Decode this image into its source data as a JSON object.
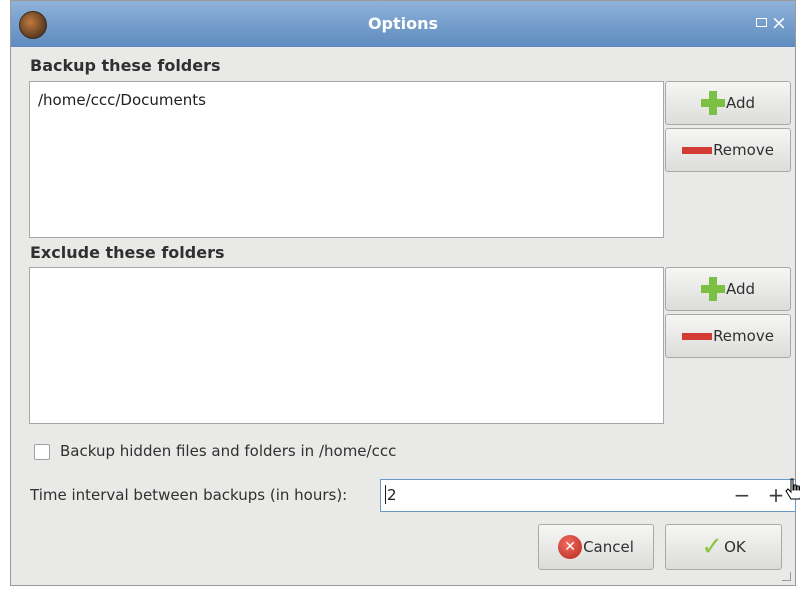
{
  "window": {
    "title": "Options"
  },
  "backup": {
    "label": "Backup these folders",
    "items": [
      "/home/ccc/Documents"
    ],
    "add_label": "Add",
    "remove_label": "Remove"
  },
  "exclude": {
    "label": "Exclude these folders",
    "items": [],
    "add_label": "Add",
    "remove_label": "Remove"
  },
  "hidden_files": {
    "label": "Backup hidden files and folders in /home/ccc",
    "checked": false
  },
  "interval": {
    "label": "Time interval between backups (in hours):",
    "value": "2",
    "minus": "−",
    "plus": "+"
  },
  "actions": {
    "cancel_label": "Cancel",
    "ok_label": "OK"
  },
  "colors": {
    "titlebar": "#5e8bbf",
    "add_icon": "#7bc043",
    "remove_icon": "#d23c34",
    "cancel_icon": "#d8473d",
    "ok_icon": "#8cc63f"
  },
  "icons": [
    "app-icon",
    "maximize-icon",
    "close-icon",
    "plus-icon",
    "minus-icon",
    "cancel-icon",
    "checkmark-icon",
    "mouse-pointer-icon"
  ]
}
